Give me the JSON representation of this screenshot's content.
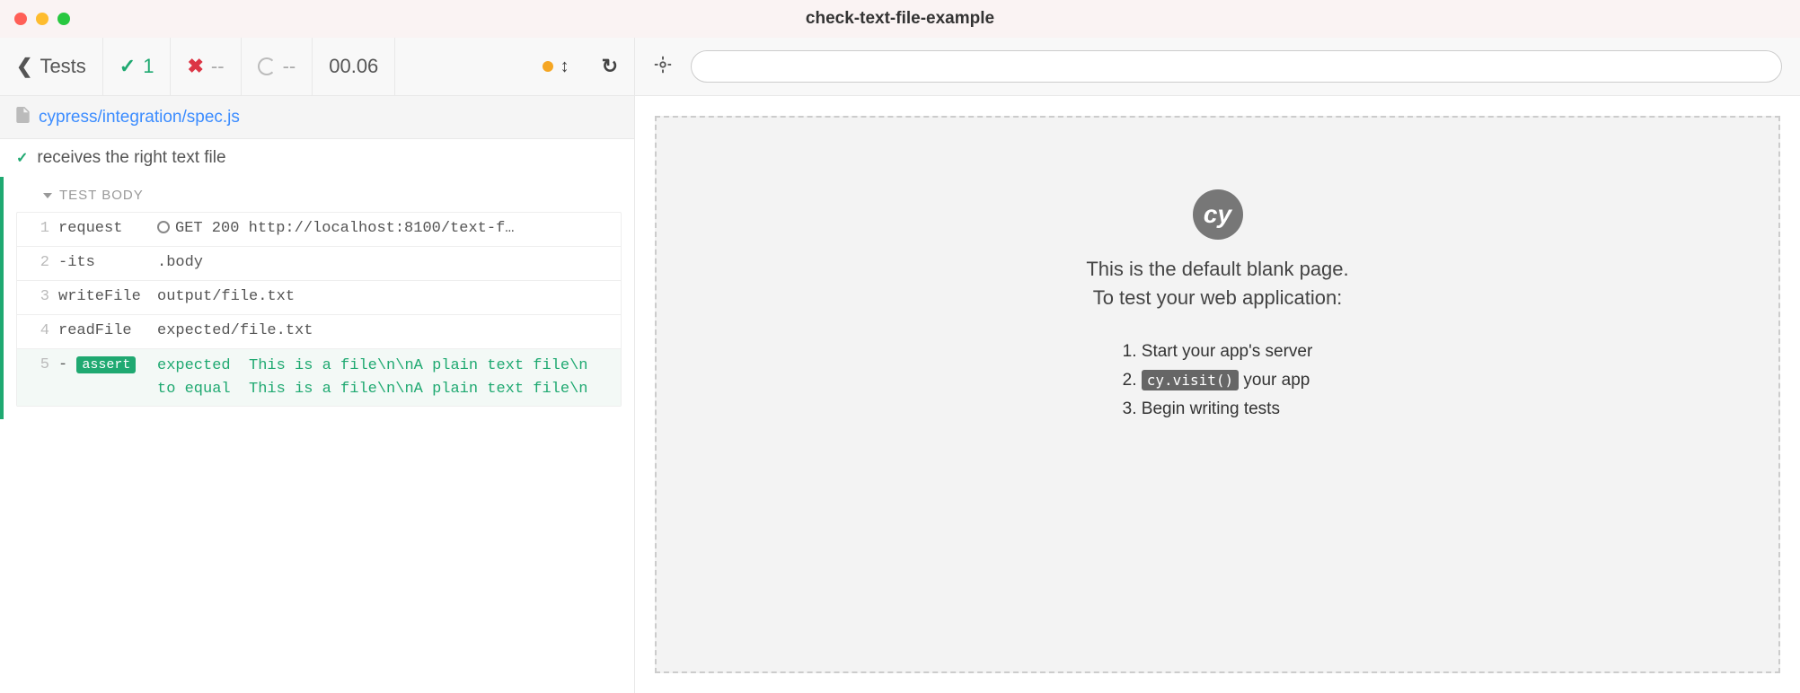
{
  "window": {
    "title": "check-text-file-example"
  },
  "toolbar": {
    "back_label": "Tests",
    "pass_count": "1",
    "fail_count": "--",
    "pending_count": "--",
    "time": "00.06"
  },
  "spec": {
    "path": "cypress/integration/spec.js"
  },
  "test": {
    "name": "receives the right text file",
    "body_label": "TEST BODY"
  },
  "commands": [
    {
      "num": "1",
      "name": "request",
      "detail_prefix": "GET 200 ",
      "detail_url": "http://localhost:8100/text-f…"
    },
    {
      "num": "2",
      "name": "-its",
      "detail": ".body"
    },
    {
      "num": "3",
      "name": "writeFile",
      "detail": "output/file.txt"
    },
    {
      "num": "4",
      "name": "readFile",
      "detail": "expected/file.txt"
    }
  ],
  "assert": {
    "num": "5",
    "dash": "-",
    "badge": "assert",
    "expected_label": "expected",
    "expected_value": "This is a file\\n\\nA plain text file\\n",
    "equal_label": "to equal",
    "actual_value": "This is a file\\n\\nA plain text file\\n"
  },
  "aut": {
    "logo": "cy",
    "line1": "This is the default blank page.",
    "line2": "To test your web application:",
    "step1": "Start your app's server",
    "step2_code": "cy.visit()",
    "step2_rest": " your app",
    "step3": "Begin writing tests"
  },
  "url": {
    "value": ""
  }
}
